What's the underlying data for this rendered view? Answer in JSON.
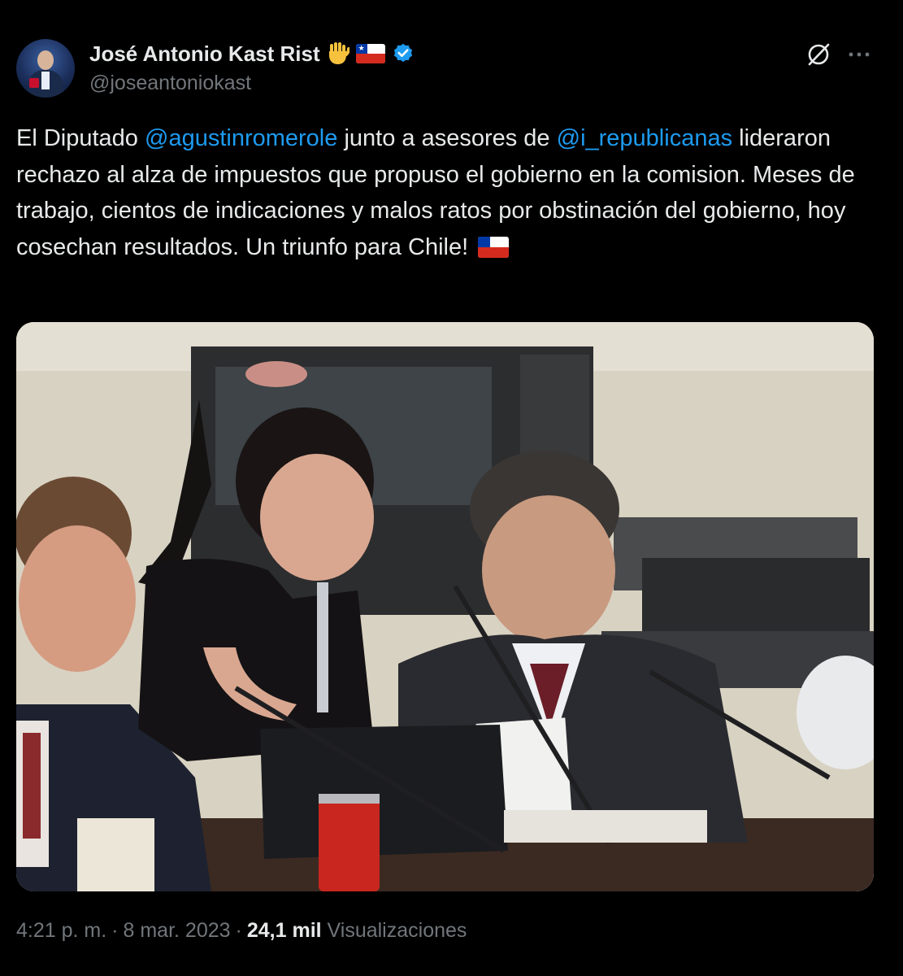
{
  "author": {
    "display_name": "José Antonio Kast Rist",
    "handle": "@joseantoniokast",
    "emojis": [
      "raised-hand-icon",
      "chile-flag-icon"
    ],
    "verified": true
  },
  "tweet": {
    "segments": [
      "El Diputado ",
      "@agustinromerole",
      " junto a asesores de ",
      "@i_republicanas",
      " lideraron rechazo al alza de impuestos que propuso el gobierno en la comision. Meses de trabajo, cientos de indicaciones y malos ratos por obstinación del gobierno, hoy cosechan resultados. Un triunfo para Chile! "
    ],
    "trailing_emoji": "chile-flag-icon"
  },
  "footer": {
    "time": "4:21 p. m.",
    "separator": "·",
    "date": "8 mar. 2023",
    "views_count": "24,1 mil",
    "views_label": "Visualizaciones"
  },
  "colors": {
    "background": "#000000",
    "text": "#e7e9ea",
    "secondary": "#71767b",
    "link": "#1d9bf0",
    "verified": "#1d9bf0"
  }
}
